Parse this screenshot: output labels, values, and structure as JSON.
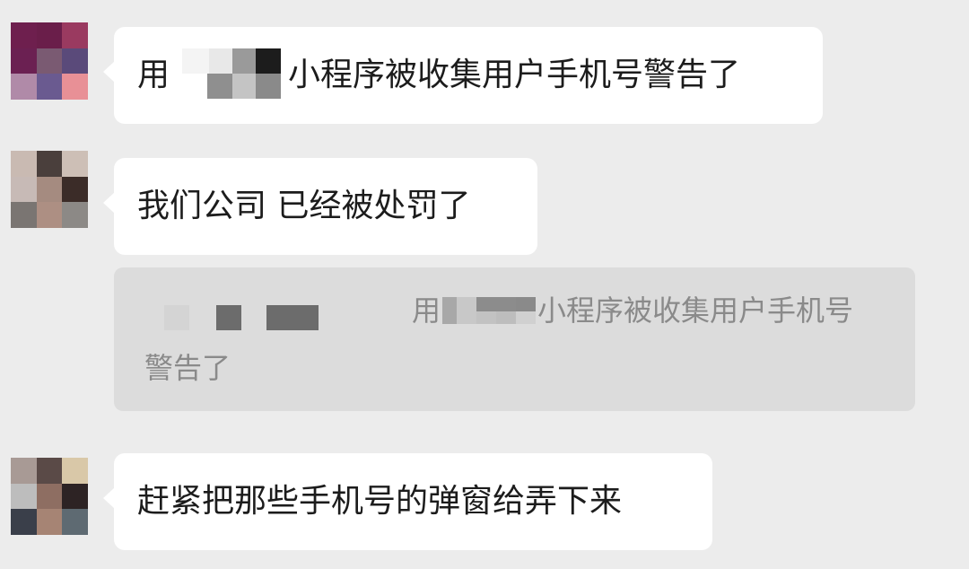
{
  "chat": {
    "messages": [
      {
        "before": "用",
        "after": "小程序被收集用户手机号警告了",
        "avatar": [
          "#6e1f4e",
          "#6a1e4a",
          "#9a3a60",
          "#6b2052",
          "#7a5a72",
          "#5a4a7a",
          "#b08aa8",
          "#6a5a90",
          "#e89096"
        ]
      },
      {
        "text": "我们公司 已经被处罚了",
        "avatar": [
          "#c9bab2",
          "#4a3f3c",
          "#cdbfb6",
          "#c7bab6",
          "#a58b80",
          "#3b2c28",
          "#7a7572",
          "#ad8f83",
          "#8c8986"
        ]
      },
      {
        "text": "赶紧把那些手机号的弹窗给弄下来",
        "avatar": [
          "#a89a95",
          "#5a4a47",
          "#d9c8a8",
          "#bdbdbd",
          "#8e6e62",
          "#2d2324",
          "#3a3f4a",
          "#a68474",
          "#5e6a72"
        ]
      }
    ],
    "quote": {
      "before": "用",
      "after": "小程序被收集用户手机号",
      "line2": "警告了"
    }
  }
}
